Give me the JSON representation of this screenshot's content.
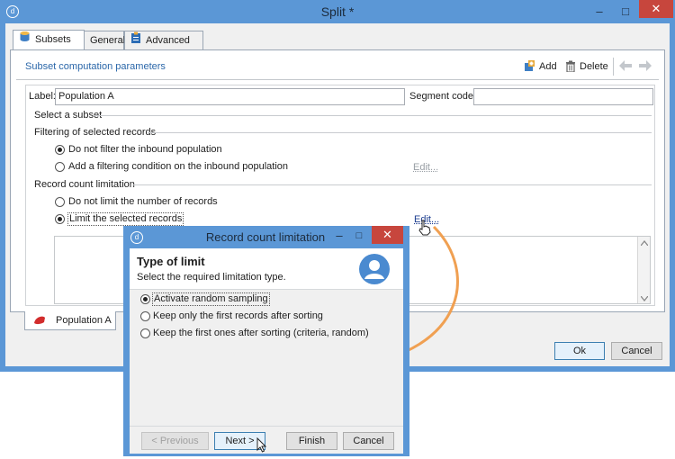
{
  "main_window": {
    "title": "Split *",
    "logo_glyph": "d",
    "controls": {
      "minimize": "–",
      "maximize": "□",
      "close": "✕"
    },
    "tabs": [
      {
        "label": "Subsets",
        "icon": "database-icon",
        "active": true
      },
      {
        "label": "General",
        "active": false
      },
      {
        "label": "Advanced",
        "icon": "clipboard-icon",
        "active": false
      }
    ],
    "section_title": "Subset computation parameters",
    "toolbar": {
      "add_label": "Add",
      "delete_label": "Delete"
    },
    "label_field": {
      "label": "Label:",
      "value": "Population A"
    },
    "segment_field": {
      "label": "Segment code:",
      "value": ""
    },
    "select_subset_title": "Select a subset",
    "filtering": {
      "title": "Filtering of selected records",
      "options": [
        {
          "label": "Do not filter the inbound population",
          "selected": true
        },
        {
          "label": "Add a filtering condition on the inbound population",
          "selected": false
        }
      ],
      "edit_label": "Edit..."
    },
    "record_limit": {
      "title": "Record count limitation",
      "options": [
        {
          "label": "Do not limit the number of records",
          "selected": false
        },
        {
          "label": "Limit the selected records",
          "selected": true
        }
      ],
      "edit_label": "Edit..."
    },
    "subset_tab": {
      "label": "Population A"
    },
    "ok_label": "Ok",
    "cancel_label": "Cancel"
  },
  "dialog": {
    "title": "Record count limitation",
    "controls": {
      "minimize": "–",
      "maximize": "□",
      "close": "✕"
    },
    "heading": "Type of limit",
    "subheading": "Select the required limitation type.",
    "options": [
      {
        "label": "Activate random sampling",
        "selected": true
      },
      {
        "label": "Keep only the first records after sorting",
        "selected": false
      },
      {
        "label": "Keep the first ones after sorting (criteria, random)",
        "selected": false
      }
    ],
    "buttons": {
      "previous": "< Previous",
      "next": "Next >",
      "finish": "Finish",
      "cancel": "Cancel"
    }
  },
  "colors": {
    "window_frame": "#5b97d6",
    "accent_link": "#2b67a9",
    "close_button": "#c7463d",
    "annotation_arrow": "#f0a052"
  }
}
